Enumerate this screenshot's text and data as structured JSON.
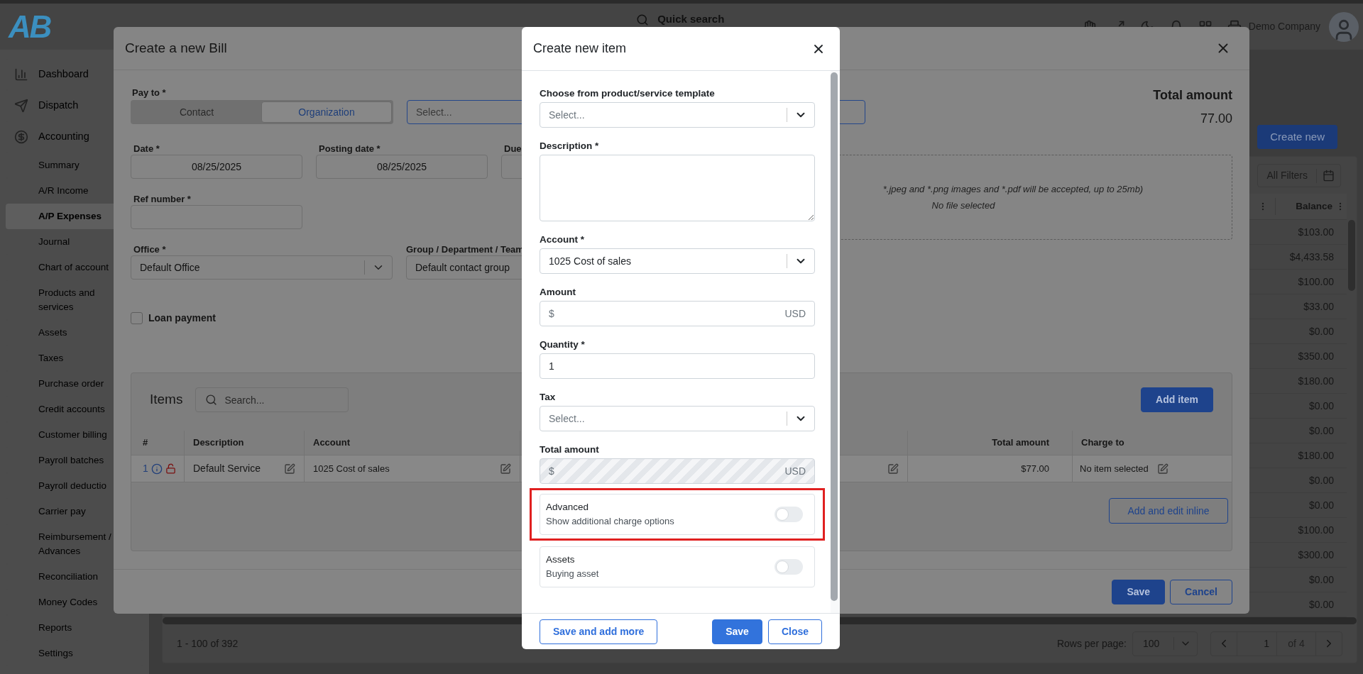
{
  "header": {
    "logo": "AB",
    "search": "Quick search",
    "company": "Demo Company"
  },
  "sidebar": {
    "items": [
      {
        "label": "Dashboard",
        "kind": "main",
        "selected": false
      },
      {
        "label": "Dispatch",
        "kind": "main",
        "selected": false
      },
      {
        "label": "Accounting",
        "kind": "main",
        "selected": false
      },
      {
        "label": "Summary",
        "kind": "sub",
        "selected": false
      },
      {
        "label": "A/R Income",
        "kind": "sub",
        "selected": false
      },
      {
        "label": "A/P Expenses",
        "kind": "sub",
        "selected": true
      },
      {
        "label": "Journal",
        "kind": "sub",
        "selected": false
      },
      {
        "label": "Chart of account",
        "kind": "sub",
        "selected": false
      },
      {
        "label": "Products and services",
        "kind": "sub",
        "selected": false
      },
      {
        "label": "Assets",
        "kind": "sub",
        "selected": false
      },
      {
        "label": "Taxes",
        "kind": "sub",
        "selected": false
      },
      {
        "label": "Purchase order",
        "kind": "sub",
        "selected": false
      },
      {
        "label": "Credit accounts",
        "kind": "sub",
        "selected": false
      },
      {
        "label": "Customer billing",
        "kind": "sub",
        "selected": false
      },
      {
        "label": "Payroll batches",
        "kind": "sub",
        "selected": false
      },
      {
        "label": "Payroll deductio",
        "kind": "sub",
        "selected": false
      },
      {
        "label": "Carrier pay",
        "kind": "sub",
        "selected": false
      },
      {
        "label": "Reimbursement / Advances",
        "kind": "sub",
        "selected": false
      },
      {
        "label": "Reconciliation",
        "kind": "sub",
        "selected": false
      },
      {
        "label": "Money Codes",
        "kind": "sub",
        "selected": false
      },
      {
        "label": "Reports",
        "kind": "sub",
        "selected": false
      },
      {
        "label": "Settings",
        "kind": "sub",
        "selected": false
      }
    ]
  },
  "list_page": {
    "create_button": "Create new",
    "filters_button": "All Filters",
    "table": {
      "column": "Balance",
      "rows": [
        "$103.00",
        "$4,433.58",
        "$100.00",
        "$33.00",
        "$0.00",
        "$350.00",
        "$180.00",
        "$0.00",
        "$0.00",
        "$180.00",
        "$0.00",
        "$0.00",
        "$100.00",
        "$300.00",
        "$0.00",
        "$0.00"
      ]
    },
    "range": "1 - 100 of 392",
    "rows_per_page_label": "Rows per page:",
    "rows_per_page": "100",
    "page": "1",
    "page_count": "of 4"
  },
  "bill_dialog": {
    "title": "Create a new Bill",
    "pay_to": {
      "label": "Pay to *",
      "options": [
        {
          "label": "Contact",
          "selected": false
        },
        {
          "label": "Organization",
          "selected": true
        }
      ],
      "select": {
        "placeholder": "Select...",
        "focused": true
      }
    },
    "dates": [
      {
        "label": "Date *",
        "value": "08/25/2025"
      },
      {
        "label": "Posting date *",
        "value": "08/25/2025"
      },
      {
        "label": "Due"
      }
    ],
    "ref_number": {
      "label": "Ref number *"
    },
    "office": {
      "label": "Office *",
      "value": "Default Office"
    },
    "group": {
      "label": "Group / Department / Team",
      "value": "Default contact group"
    },
    "loan_payment": {
      "label": "Loan payment",
      "checked": false
    },
    "total": {
      "label": "Total amount",
      "value": "77.00"
    },
    "upload": {
      "hint": "*.jpeg and *.png images and *.pdf will be accepted, up to 25mb)",
      "status": "No file selected"
    },
    "items": {
      "title": "Items",
      "search_placeholder": "Search...",
      "add_button": "Add item",
      "columns": [
        {
          "label": "#"
        },
        {
          "label": "Description"
        },
        {
          "label": "Account"
        },
        {
          "label": "Total amount"
        },
        {
          "label": "Charge to"
        }
      ],
      "rows": [
        {
          "number": "1",
          "description": "Default Service",
          "account": "1025 Cost of sales",
          "total": "$77.00",
          "charge_to": "No item selected"
        }
      ],
      "inline_button": "Add and edit inline"
    },
    "buttons": [
      {
        "label": "Save",
        "kind": "primary"
      },
      {
        "label": "Cancel",
        "kind": "outline"
      }
    ]
  },
  "item_dialog": {
    "title": "Create new item",
    "fields": [
      {
        "label": "Choose from product/service template",
        "kind": "select",
        "placeholder": "Select..."
      },
      {
        "label": "Description *",
        "kind": "textarea"
      },
      {
        "label": "Account *",
        "kind": "select",
        "value": "1025 Cost of sales"
      },
      {
        "label": "Amount",
        "kind": "money",
        "prefix": "$",
        "suffix": "USD",
        "disabled": false
      },
      {
        "label": "Quantity *",
        "kind": "text",
        "value": "1"
      },
      {
        "label": "Tax",
        "kind": "select",
        "placeholder": "Select..."
      },
      {
        "label": "Total amount",
        "kind": "money",
        "prefix": "$",
        "suffix": "USD",
        "disabled": true
      }
    ],
    "toggles": [
      {
        "title": "Advanced",
        "subtitle": "Show additional charge options",
        "on": false,
        "highlighted": true
      },
      {
        "title": "Assets",
        "subtitle": "Buying asset",
        "on": false,
        "highlighted": false
      }
    ],
    "buttons": [
      {
        "label": "Save and add more",
        "kind": "outline"
      },
      {
        "label": "Save",
        "kind": "primary"
      },
      {
        "label": "Close",
        "kind": "outline"
      }
    ]
  }
}
